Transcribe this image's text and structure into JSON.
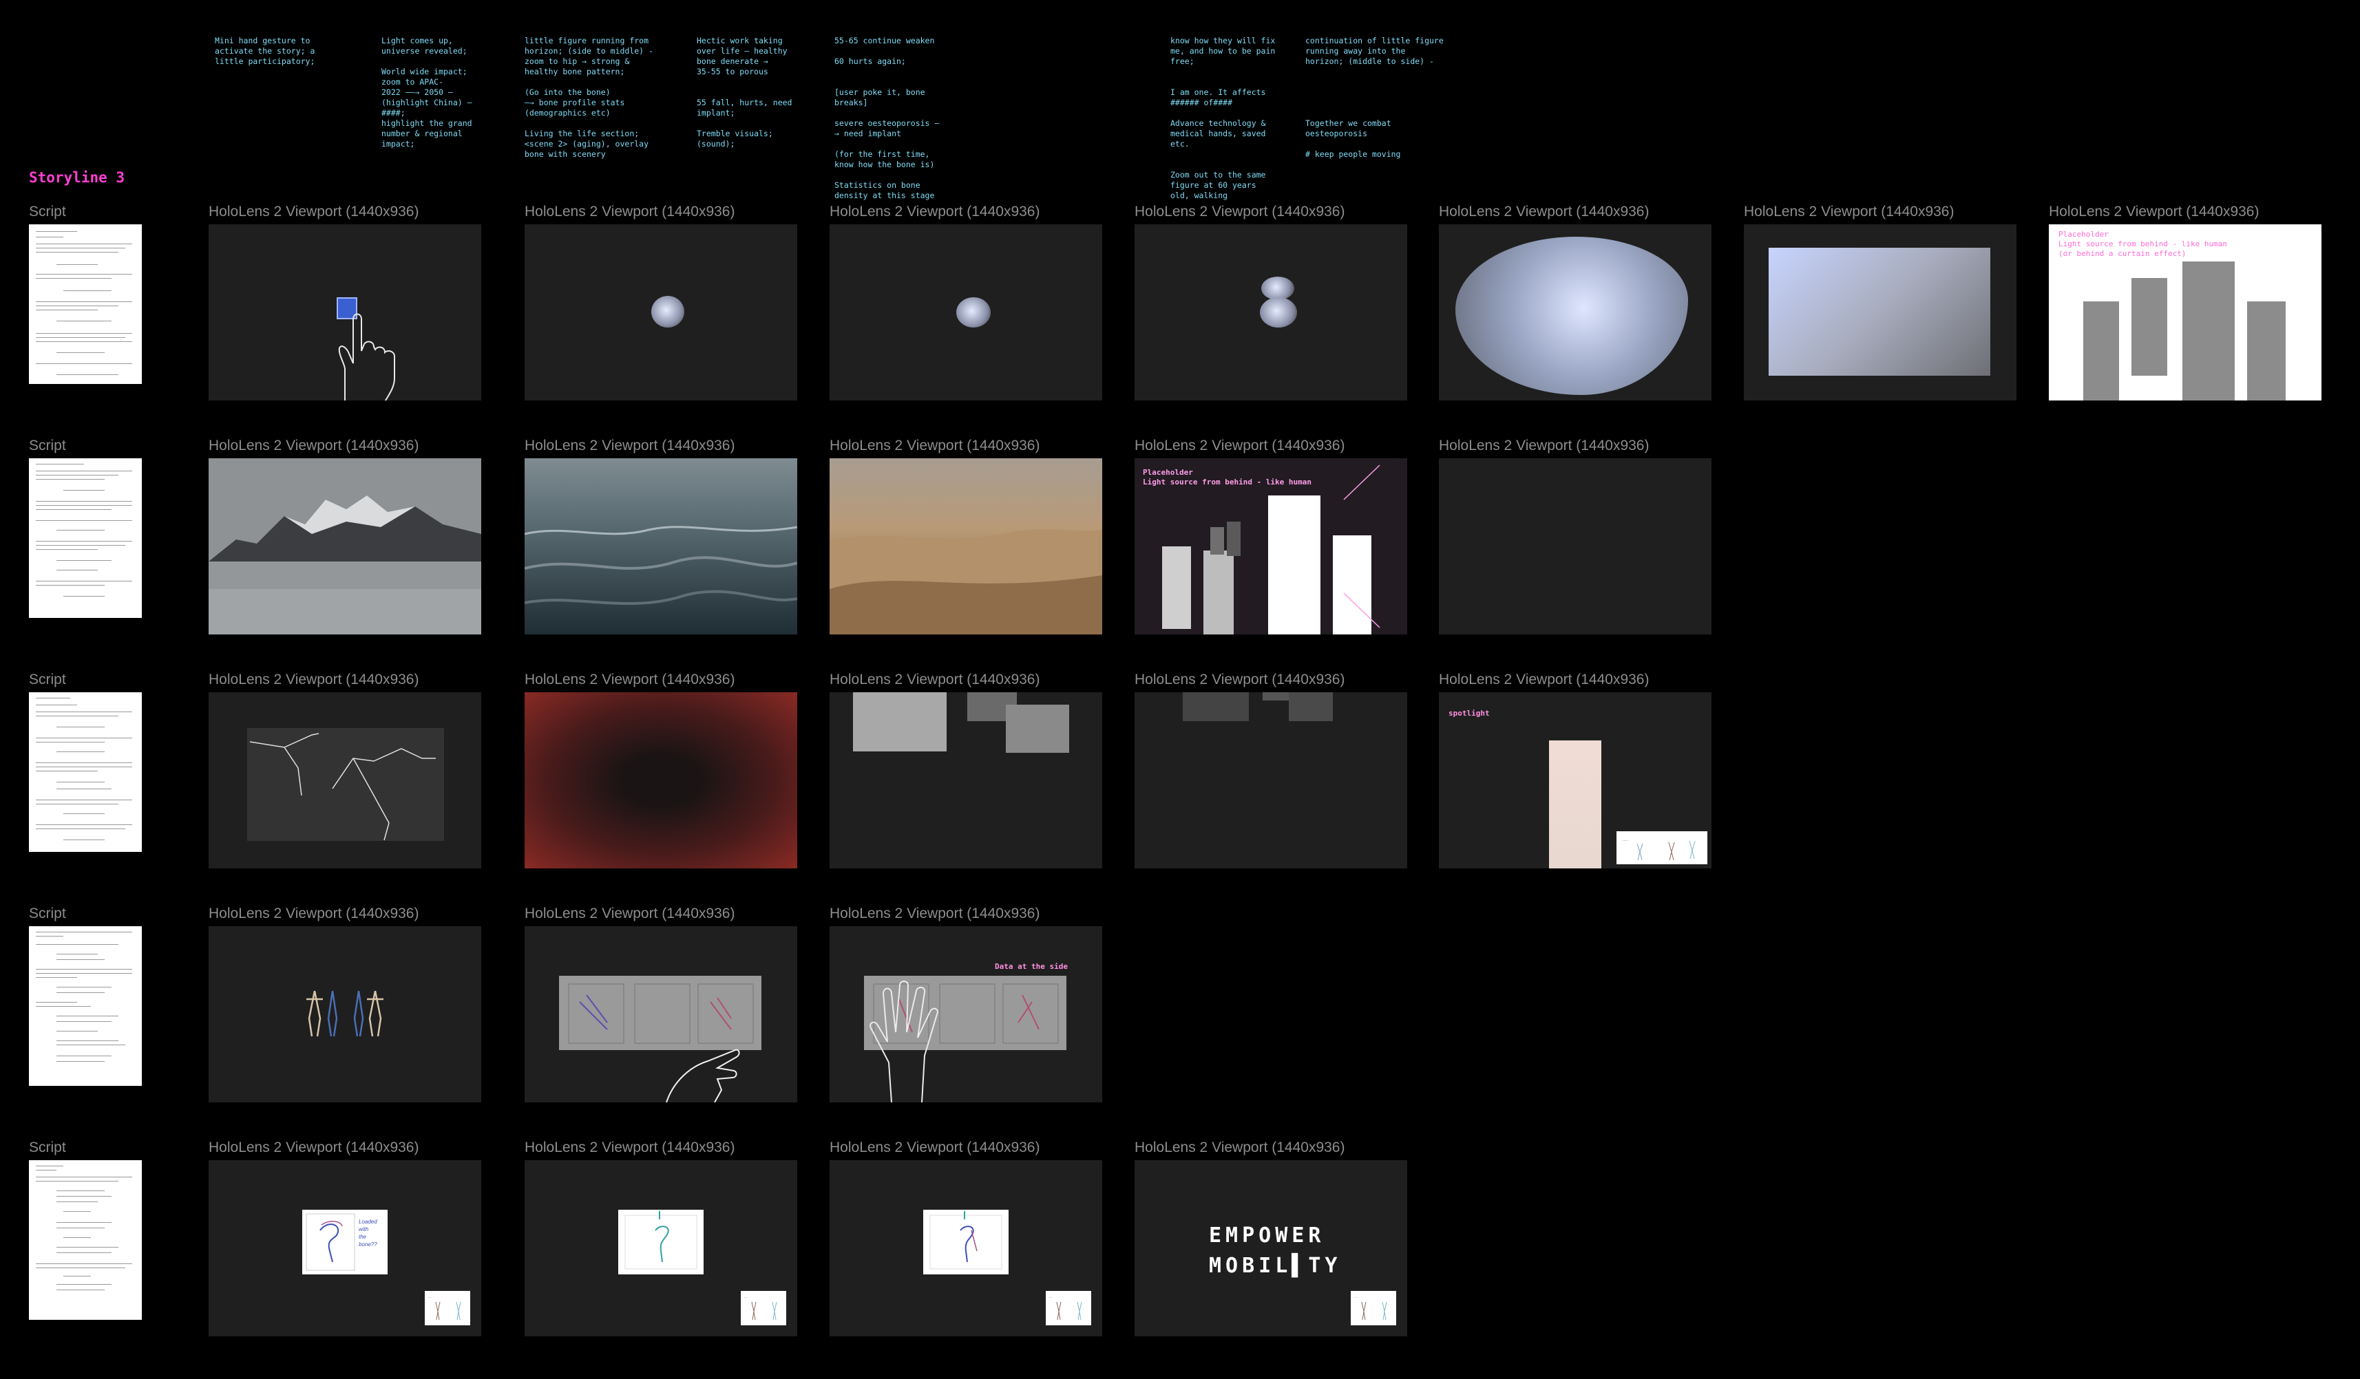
{
  "canvas": {
    "section_title": "Storyline 3"
  },
  "notes": [
    "Mini hand gesture to\nactivate the story; a\nlittle participatory;",
    "Light comes up,\nuniverse revealed;\n\nWorld wide impact;\nzoom to APAC-\n2022 ——→ 2050 –\n(highlight China) –\n####;\nhighlight the grand\nnumber & regional\nimpact;",
    "little figure running from\nhorizon; (side to middle) -\nzoom to hip → strong &\nhealthy bone pattern;\n\n(Go into the bone)\n—→ bone profile stats\n(demographics etc)\n\nLiving the life section;\n<scene 2> (aging), overlay\nbone with scenery",
    "Hectic work taking\nover life – healthy\nbone denerate →\n35-55 to porous\n\n\n55 fall, hurts, need\nimplant;\n\nTremble visuals;\n(sound);",
    "55-65 continue weaken\n\n60 hurts again;\n\n\n[user poke it, bone\nbreaks]\n\nsevere oesteoporosis –\n→ need implant\n\n(for the first time,\nknow how the bone is)\n\nStatistics on bone\ndensity at this stage",
    "know how they will fix\nme, and how to be pain\nfree;\n\n\nI am one. It affects\n###### of####\n\nAdvance technology &\nmedical hands, saved\netc.\n\n\nZoom out to the same\nfigure at 60 years\nold, walking",
    "continuation of little figure\nrunning away into the\nhorizon; (middle to side) -\n\n\n\n\n\nTogether we combat\noesteoporosis\n\n# keep people moving"
  ],
  "labels": {
    "script": "Script",
    "viewport": "HoloLens 2 Viewport (1440x936)"
  },
  "frames": {
    "placeholder_white": {
      "title": "Placeholder",
      "line2": "Light source from behind - like human",
      "line3": "(or behind a curtain effect)"
    },
    "placeholder_dark": {
      "title": "Placeholder",
      "line2": "Light source from behind - like human"
    },
    "spotlight": "spotlight",
    "data_side": "Data at the side",
    "sketch_note": "Loaded\nwith\nthe\nbone??",
    "empower_line1": "EMPOWER",
    "empower_line2": "MOBIL▌TY"
  },
  "colors": {
    "background": "#000000",
    "frame": "#1f1f1f",
    "label": "#8d8d8d",
    "note": "#7fdcf5",
    "accent": "#ff3fd2"
  },
  "icons": [
    "hand-icon",
    "bone-icon",
    "figure-icon"
  ]
}
